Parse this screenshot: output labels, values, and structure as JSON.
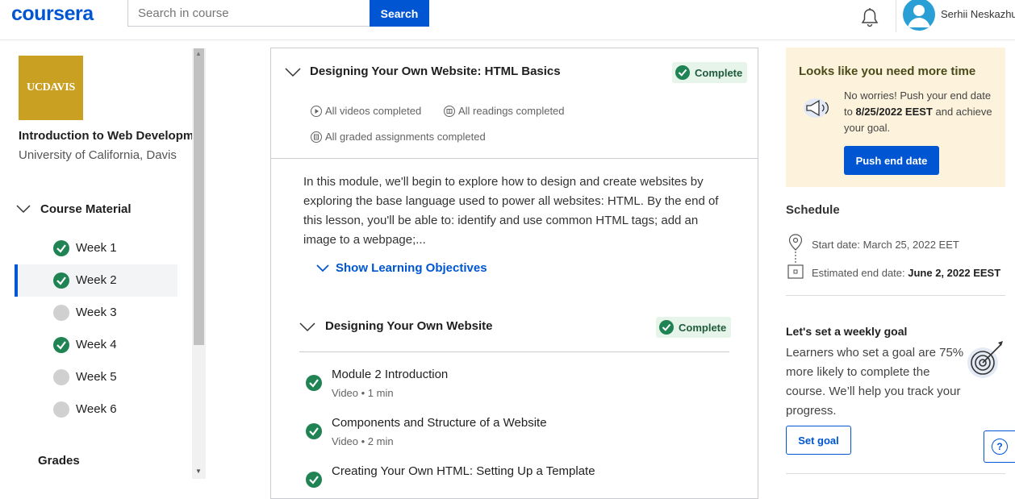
{
  "header": {
    "logo": "coursera",
    "search_placeholder": "Search in course",
    "search_button": "Search",
    "user_name": "Serhii Neskazhu"
  },
  "sidebar": {
    "logo_text": "UCDAVIS",
    "course_title": "Introduction to Web Development",
    "university": "University of California, Davis",
    "section_label": "Course Material",
    "weeks": [
      {
        "label": "Week 1",
        "status": "complete"
      },
      {
        "label": "Week 2",
        "status": "complete",
        "active": true
      },
      {
        "label": "Week 3",
        "status": "incomplete"
      },
      {
        "label": "Week 4",
        "status": "complete"
      },
      {
        "label": "Week 5",
        "status": "incomplete"
      },
      {
        "label": "Week 6",
        "status": "incomplete"
      }
    ],
    "grades_label": "Grades"
  },
  "module": {
    "title": "Designing Your Own Website: HTML Basics",
    "badge": "Complete",
    "stats": {
      "videos": "All videos completed",
      "readings": "All readings completed",
      "graded": "All graded assignments completed"
    },
    "description": "In this module, we'll begin to explore how to design and create websites by exploring the base language used to power all websites: HTML. By the end of this lesson, you'll be able to: identify and use common HTML tags; add an image to a webpage;...",
    "objectives_link": "Show Learning Objectives",
    "section": {
      "title": "Designing Your Own Website",
      "badge": "Complete",
      "items": [
        {
          "title": "Module 2 Introduction",
          "meta": "Video • 1 min"
        },
        {
          "title": "Components and Structure of a Website",
          "meta": "Video • 2 min"
        },
        {
          "title": "Creating Your Own HTML: Setting Up a Template",
          "meta": ""
        }
      ]
    }
  },
  "notice": {
    "title": "Looks like you need more time",
    "text_prefix": "No worries! Push your end date to ",
    "date": "8/25/2022 EEST",
    "text_suffix": " and achieve your goal.",
    "button": "Push end date"
  },
  "schedule": {
    "title": "Schedule",
    "start": "Start date: March 25, 2022 EET",
    "end_prefix": "Estimated end date: ",
    "end_date": "June 2, 2022 EEST"
  },
  "goal": {
    "title": "Let's set a weekly goal",
    "text": "Learners who set a goal are 75% more likely to complete the course. We’ll help you track your progress.",
    "button": "Set goal"
  },
  "help": "?",
  "colors": {
    "brand": "#0056d2",
    "complete": "#1f8354",
    "incomplete": "#d0d0d0",
    "notice_bg": "#fdf3dc"
  }
}
